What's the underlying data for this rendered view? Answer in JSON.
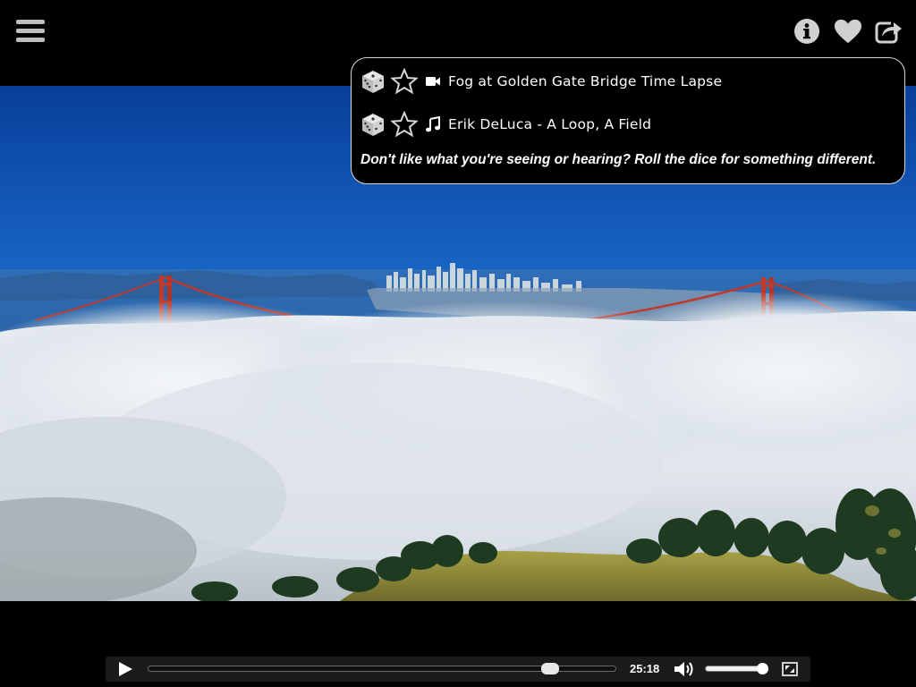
{
  "top_bar": {
    "menu_icon": "hamburger-menu-icon",
    "right_icons": [
      "info-icon",
      "heart-icon",
      "share-icon"
    ]
  },
  "info_panel": {
    "rows": [
      {
        "type": "video",
        "dice_icon": "dice-icon",
        "star_icon": "star-outline-icon",
        "kind_icon": "video-camera-icon",
        "title": "Fog at Golden Gate Bridge Time Lapse"
      },
      {
        "type": "music",
        "dice_icon": "dice-icon",
        "star_icon": "star-outline-icon",
        "kind_icon": "music-note-icon",
        "title": "Erik DeLuca - A Loop, A Field"
      }
    ],
    "note": "Don't like what you're seeing or hearing? Roll the dice for something different."
  },
  "player": {
    "time": "25:18",
    "progress_fraction": 0.86,
    "volume_fraction": 0.95,
    "icons": [
      "play-icon",
      "volume-icon",
      "fullscreen-icon"
    ]
  },
  "colors": {
    "background": "#000000",
    "sky_top": "#0a4fb0",
    "bridge": "#c0392b",
    "fog": "#e6ebef",
    "hills": "#8a8a2a"
  }
}
